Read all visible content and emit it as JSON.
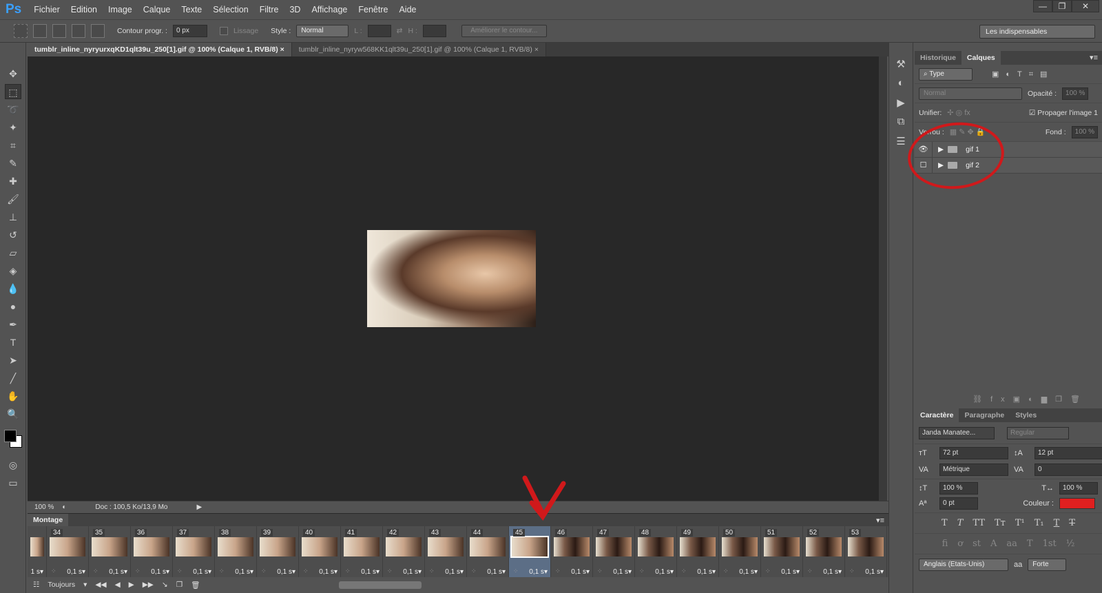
{
  "app": {
    "logo": "Ps",
    "menu": [
      "Fichier",
      "Edition",
      "Image",
      "Calque",
      "Texte",
      "Sélection",
      "Filtre",
      "3D",
      "Affichage",
      "Fenêtre",
      "Aide"
    ],
    "window_buttons": [
      "—",
      "❐",
      "✕"
    ]
  },
  "options": {
    "feather_label": "Contour progr. :",
    "feather_value": "0 px",
    "antialias_label": "Lissage",
    "style_label": "Style :",
    "style_value": "Normal",
    "width_label": "L :",
    "height_label": "H :",
    "refine_label": "Améliorer le contour...",
    "workspace": "Les indispensables"
  },
  "tabs": [
    {
      "label": "tumblr_inline_nyryurxqKD1qlt39u_250[1].gif @ 100% (Calque 1, RVB/8)",
      "close": "×"
    },
    {
      "label": "tumblr_inline_nyryw568KK1qlt39u_250[1].gif @ 100% (Calque 1, RVB/8)",
      "close": "×"
    }
  ],
  "status": {
    "zoom": "100 %",
    "doc": "Doc : 100,5 Ko/13,9 Mo"
  },
  "timeline": {
    "title": "Montage",
    "loop": "Toujours",
    "selected_frame": "45",
    "frames": [
      {
        "n": "",
        "d": "1 s"
      },
      {
        "n": "34",
        "d": "0,1 s"
      },
      {
        "n": "35",
        "d": "0,1 s"
      },
      {
        "n": "36",
        "d": "0,1 s"
      },
      {
        "n": "37",
        "d": "0,1 s"
      },
      {
        "n": "38",
        "d": "0,1 s"
      },
      {
        "n": "39",
        "d": "0,1 s"
      },
      {
        "n": "40",
        "d": "0,1 s"
      },
      {
        "n": "41",
        "d": "0,1 s"
      },
      {
        "n": "42",
        "d": "0,1 s"
      },
      {
        "n": "43",
        "d": "0,1 s"
      },
      {
        "n": "44",
        "d": "0,1 s"
      },
      {
        "n": "45",
        "d": "0,1 s"
      },
      {
        "n": "46",
        "d": "0,1 s"
      },
      {
        "n": "47",
        "d": "0,1 s"
      },
      {
        "n": "48",
        "d": "0,1 s"
      },
      {
        "n": "49",
        "d": "0,1 s"
      },
      {
        "n": "50",
        "d": "0,1 s"
      },
      {
        "n": "51",
        "d": "0,1 s"
      },
      {
        "n": "52",
        "d": "0,1 s"
      },
      {
        "n": "53",
        "d": "0,1 s"
      }
    ]
  },
  "layers": {
    "tabs": [
      "Historique",
      "Calques"
    ],
    "filter": "Type",
    "blend": "Normal",
    "opacity_label": "Opacité :",
    "opacity": "100 %",
    "unify_label": "Unifier:",
    "propagate": "Propager l'image 1",
    "lock_label": "Verrou :",
    "fill_label": "Fond :",
    "fill": "100 %",
    "items": [
      {
        "name": "gif 1",
        "visible": true
      },
      {
        "name": "gif 2",
        "visible": false
      }
    ]
  },
  "character": {
    "tabs": [
      "Caractère",
      "Paragraphe",
      "Styles"
    ],
    "font": "Janda Manatee...",
    "style": "Regular",
    "size": "72 pt",
    "leading": "12 pt",
    "kerning": "Métrique",
    "tracking": "0",
    "vscale": "100 %",
    "hscale": "100 %",
    "baseline": "0 pt",
    "color_label": "Couleur :",
    "color": "#e02020",
    "language": "Anglais (Etats-Unis)",
    "aa_icon": "aa",
    "antialias": "Forte",
    "typo_buttons": [
      "T",
      "T",
      "TT",
      "Tт",
      "T¹",
      "T₁",
      "T",
      "T"
    ],
    "ot_buttons": [
      "fi",
      "ơ",
      "st",
      "A",
      "aa",
      "T",
      "1st",
      "½"
    ]
  },
  "annotation_color": "#d0191b"
}
